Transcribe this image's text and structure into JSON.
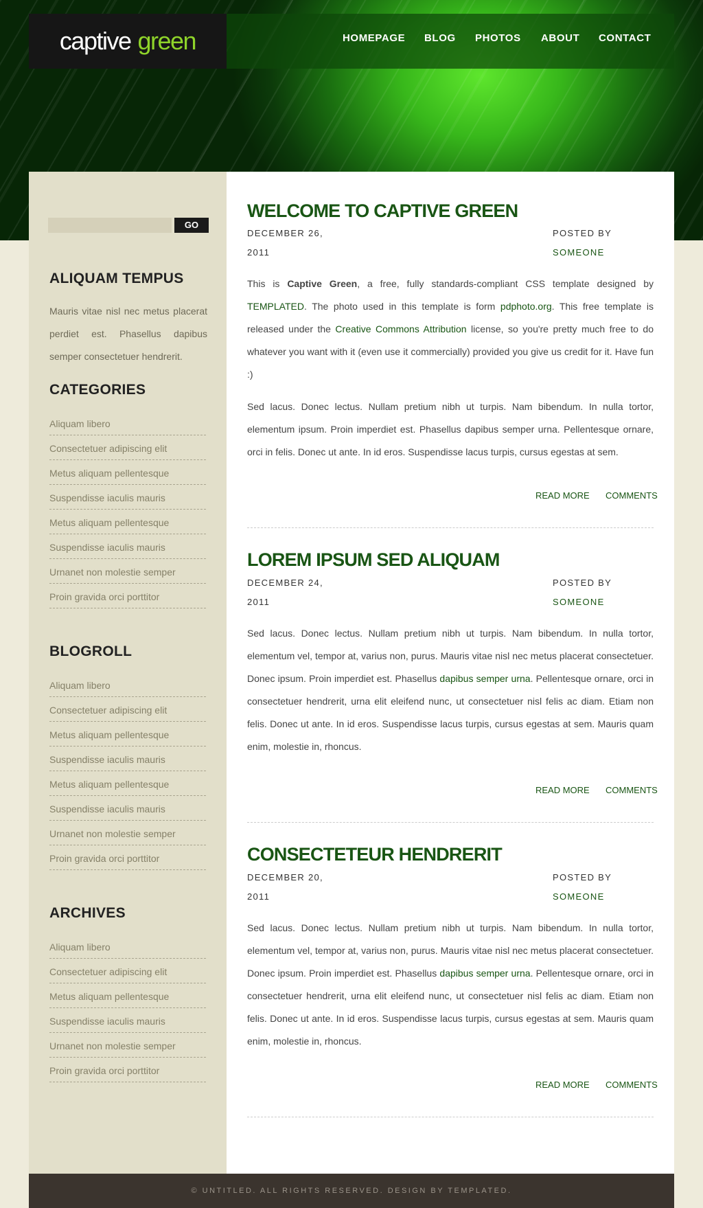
{
  "brand": {
    "name_white": "captive",
    "name_green": "green"
  },
  "nav": [
    "HOMEPAGE",
    "BLOG",
    "PHOTOS",
    "ABOUT",
    "CONTACT"
  ],
  "search": {
    "button": "GO",
    "value": ""
  },
  "sidebar": {
    "about": {
      "title": "ALIQUAM TEMPUS",
      "text": "Mauris vitae nisl nec metus placerat perdiet est. Phasellus dapibus semper consectetuer hendrerit."
    },
    "categories": {
      "title": "CATEGORIES",
      "items": [
        "Aliquam libero",
        "Consectetuer adipiscing elit",
        "Metus aliquam pellentesque",
        "Suspendisse iaculis mauris",
        "Metus aliquam pellentesque",
        "Suspendisse iaculis mauris",
        "Urnanet non molestie semper",
        "Proin gravida orci porttitor"
      ]
    },
    "blogroll": {
      "title": "BLOGROLL",
      "items": [
        "Aliquam libero",
        "Consectetuer adipiscing elit",
        "Metus aliquam pellentesque",
        "Suspendisse iaculis mauris",
        "Metus aliquam pellentesque",
        "Suspendisse iaculis mauris",
        "Urnanet non molestie semper",
        "Proin gravida orci porttitor"
      ]
    },
    "archives": {
      "title": "ARCHIVES",
      "items": [
        "Aliquam libero",
        "Consectetuer adipiscing elit",
        "Metus aliquam pellentesque",
        "Suspendisse iaculis mauris",
        "Urnanet non molestie semper",
        "Proin gravida orci porttitor"
      ]
    }
  },
  "posts": [
    {
      "title": "WELCOME TO CAPTIVE GREEN",
      "date_line1": "DECEMBER 26,",
      "date_line2": "2011",
      "posted_by": "POSTED BY",
      "author": "SOMEONE",
      "p1": {
        "t1": "This is ",
        "bold": "Captive Green",
        "t2": ", a free, fully standards-compliant CSS template designed by ",
        "link1": "TEMPLATED",
        "t3": ". The photo used in this template is form ",
        "link2": "pdphoto.org",
        "t4": ". This free template is released under the ",
        "link3": "Creative Commons Attribution",
        "t5": " license, so you're pretty much free to do whatever you want with it (even use it commercially) provided you give us credit for it. Have fun :)"
      },
      "p2": "Sed lacus. Donec lectus. Nullam pretium nibh ut turpis. Nam bibendum. In nulla tortor, elementum ipsum. Proin imperdiet est. Phasellus dapibus semper urna. Pellentesque ornare, orci in felis. Donec ut ante. In id eros. Suspendisse lacus turpis, cursus egestas at sem.",
      "read_more": "READ MORE",
      "comments": "COMMENTS"
    },
    {
      "title": "LOREM IPSUM SED ALIQUAM",
      "date_line1": "DECEMBER 24,",
      "date_line2": "2011",
      "posted_by": "POSTED BY",
      "author": "SOMEONE",
      "p1": {
        "t1": "Sed lacus. Donec lectus. Nullam pretium nibh ut turpis. Nam bibendum. In nulla tortor, elementum vel, tempor at, varius non, purus. Mauris vitae nisl nec metus placerat consectetuer. Donec ipsum. Proin imperdiet est. Phasellus ",
        "link": "dapibus semper urna",
        "t2": ". Pellentesque ornare, orci in consectetuer hendrerit, urna elit eleifend nunc, ut consectetuer nisl felis ac diam. Etiam non felis. Donec ut ante. In id eros. Suspendisse lacus turpis, cursus egestas at sem. Mauris quam enim, molestie in, rhoncus."
      },
      "read_more": "READ MORE",
      "comments": "COMMENTS"
    },
    {
      "title": "CONSECTETEUR HENDRERIT",
      "date_line1": "DECEMBER 20,",
      "date_line2": "2011",
      "posted_by": "POSTED BY",
      "author": "SOMEONE",
      "p1": {
        "t1": "Sed lacus. Donec lectus. Nullam pretium nibh ut turpis. Nam bibendum. In nulla tortor, elementum vel, tempor at, varius non, purus. Mauris vitae nisl nec metus placerat consectetuer. Donec ipsum. Proin imperdiet est. Phasellus ",
        "link": "dapibus semper urna",
        "t2": ". Pellentesque ornare, orci in consectetuer hendrerit, urna elit eleifend nunc, ut consectetuer nisl felis ac diam. Etiam non felis. Donec ut ante. In id eros. Suspendisse lacus turpis, cursus egestas at sem. Mauris quam enim, molestie in, rhoncus."
      },
      "read_more": "READ MORE",
      "comments": "COMMENTS"
    }
  ],
  "footer": {
    "text": "© UNTITLED. ALL RIGHTS RESERVED. DESIGN BY TEMPLATED."
  },
  "colors": {
    "accent_green": "#195514",
    "logo_green": "#8fd42a",
    "sidebar_bg": "#e2dfca",
    "footer_bg": "#3b342e",
    "page_bg": "#eeebdb"
  }
}
